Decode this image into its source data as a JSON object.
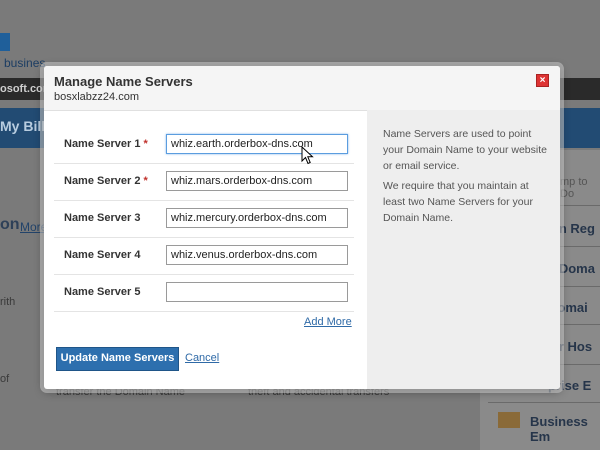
{
  "background": {
    "brand_text": "busines",
    "site_text": "osoft.com",
    "page_heading": "My Billin",
    "section_heading": "on",
    "section_link": "More",
    "jump_text": "mp to Do",
    "right_items": [
      "ain Reg",
      "e Doma",
      "Domai",
      "ler Hos",
      "prise E"
    ],
    "business_email": "Business Em",
    "footer_left": "transfer the Domain Name",
    "footer_right": "theft and accidental transfers",
    "side_fragments": [
      "rith",
      "of"
    ]
  },
  "modal": {
    "title": "Manage Name Servers",
    "domain": "bosxlabzz24.com",
    "close_label": "×",
    "fields": [
      {
        "label": "Name Server 1",
        "required": true,
        "value": "whiz.earth.orderbox-dns.com"
      },
      {
        "label": "Name Server 2",
        "required": true,
        "value": "whiz.mars.orderbox-dns.com"
      },
      {
        "label": "Name Server 3",
        "required": false,
        "value": "whiz.mercury.orderbox-dns.com"
      },
      {
        "label": "Name Server 4",
        "required": false,
        "value": "whiz.venus.orderbox-dns.com"
      },
      {
        "label": "Name Server 5",
        "required": false,
        "value": ""
      }
    ],
    "required_marker": "*",
    "add_more_label": "Add More",
    "update_button_label": "Update Name Servers",
    "cancel_label": "Cancel",
    "info_text_1": "Name Servers are used to point your Domain Name to your website or email service.",
    "info_text_2": "We require that you maintain at least two Name Servers for your Domain Name."
  },
  "colors": {
    "primary_button": "#2d6fae",
    "link": "#2f6aa7",
    "required": "#c0302a",
    "close": "#dd3333"
  }
}
